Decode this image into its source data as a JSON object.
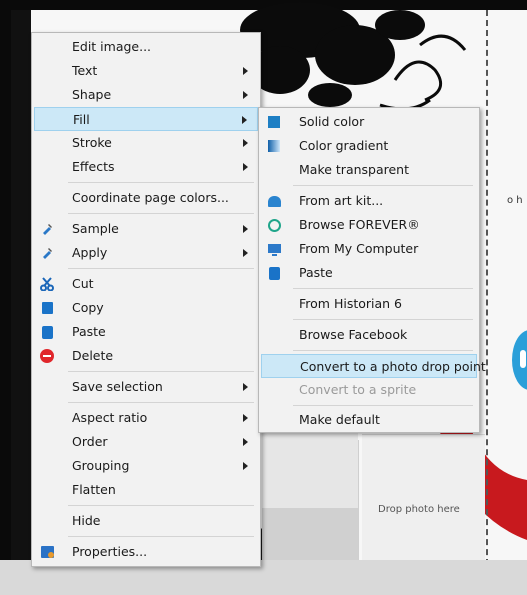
{
  "canvas": {
    "drop_photo_text": "Drop photo here",
    "edge_text": "o h"
  },
  "main_menu": {
    "items": [
      {
        "label": "Edit image...",
        "icon": "",
        "submenu": false
      },
      {
        "label": "Text",
        "icon": "",
        "submenu": true
      },
      {
        "label": "Shape",
        "icon": "",
        "submenu": true
      },
      {
        "label": "Fill",
        "icon": "",
        "submenu": true,
        "highlighted": true
      },
      {
        "label": "Stroke",
        "icon": "",
        "submenu": true
      },
      {
        "label": "Effects",
        "icon": "",
        "submenu": true
      },
      {
        "label": "Coordinate page colors...",
        "icon": "",
        "submenu": false
      },
      {
        "label": "Sample",
        "icon": "eyedropper-icon",
        "submenu": true
      },
      {
        "label": "Apply",
        "icon": "eyedropper-icon",
        "submenu": true
      },
      {
        "label": "Cut",
        "icon": "scissors-icon",
        "submenu": false
      },
      {
        "label": "Copy",
        "icon": "copy-icon",
        "submenu": false
      },
      {
        "label": "Paste",
        "icon": "paste-icon",
        "submenu": false
      },
      {
        "label": "Delete",
        "icon": "delete-icon",
        "submenu": false
      },
      {
        "label": "Save selection",
        "icon": "",
        "submenu": true
      },
      {
        "label": "Aspect ratio",
        "icon": "",
        "submenu": true
      },
      {
        "label": "Order",
        "icon": "",
        "submenu": true
      },
      {
        "label": "Grouping",
        "icon": "",
        "submenu": true
      },
      {
        "label": "Flatten",
        "icon": "",
        "submenu": false
      },
      {
        "label": "Hide",
        "icon": "",
        "submenu": false
      },
      {
        "label": "Properties...",
        "icon": "properties-icon",
        "submenu": false
      }
    ]
  },
  "fill_submenu": {
    "items": [
      {
        "label": "Solid color",
        "icon": "solid-color-icon"
      },
      {
        "label": "Color gradient",
        "icon": "gradient-icon"
      },
      {
        "label": "Make transparent",
        "icon": ""
      },
      {
        "label": "From art kit...",
        "icon": "art-kit-icon"
      },
      {
        "label": "Browse FOREVER®",
        "icon": "forever-ring-icon"
      },
      {
        "label": "From My Computer",
        "icon": "computer-icon"
      },
      {
        "label": "Paste",
        "icon": "paste-icon"
      },
      {
        "label": "From Historian 6",
        "icon": ""
      },
      {
        "label": "Browse Facebook",
        "icon": ""
      },
      {
        "label": "Convert to a photo drop point",
        "icon": "",
        "highlighted": true
      },
      {
        "label": "Convert to a sprite",
        "icon": "",
        "disabled": true
      },
      {
        "label": "Make default",
        "icon": ""
      }
    ]
  },
  "colors": {
    "highlight": "#cce8f7",
    "menu_bg": "#f2f2f2",
    "accent_blue": "#1e7fc4",
    "delete_red": "#e0262b",
    "arrow_red": "#c8191e",
    "info_blue": "#2b9fd9"
  }
}
